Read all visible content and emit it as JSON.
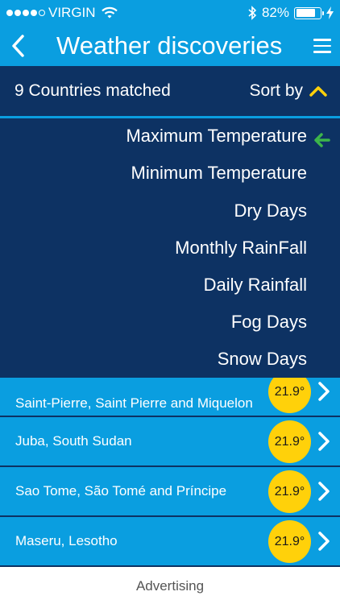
{
  "status_bar": {
    "carrier": "VIRGIN",
    "battery_percent": "82%",
    "battery_level": 0.82,
    "signal_bars": 4,
    "icons": [
      "wifi-icon",
      "bluetooth-icon",
      "charging-icon"
    ]
  },
  "nav": {
    "title": "Weather discoveries",
    "back_icon": "chevron-left-icon",
    "menu_icon": "hamburger-icon"
  },
  "filter": {
    "matched_label": "9 Countries matched",
    "sort_label": "Sort by",
    "sort_icon": "chevron-up-icon"
  },
  "sort_options": [
    "Maximum Temperature",
    "Minimum Temperature",
    "Dry Days",
    "Monthly RainFall",
    "Daily Rainfall",
    "Fog Days",
    "Snow Days"
  ],
  "selected_option": "Maximum Temperature",
  "results": [
    {
      "place": "Saint-Pierre, Saint Pierre and Miquelon",
      "temp": "21.9°"
    },
    {
      "place": "Juba, South Sudan",
      "temp": "21.9°"
    },
    {
      "place": "Sao Tome, São Tomé and Príncipe",
      "temp": "21.9°"
    },
    {
      "place": "Maseru, Lesotho",
      "temp": "21.9°"
    }
  ],
  "footer": {
    "ad_label": "Advertising"
  },
  "colors": {
    "accent_blue": "#0a9ee0",
    "navy": "#0d3263",
    "badge_yellow": "#ffd10a",
    "check_green": "#3cb54a",
    "sort_arrow": "#ffd10a"
  }
}
